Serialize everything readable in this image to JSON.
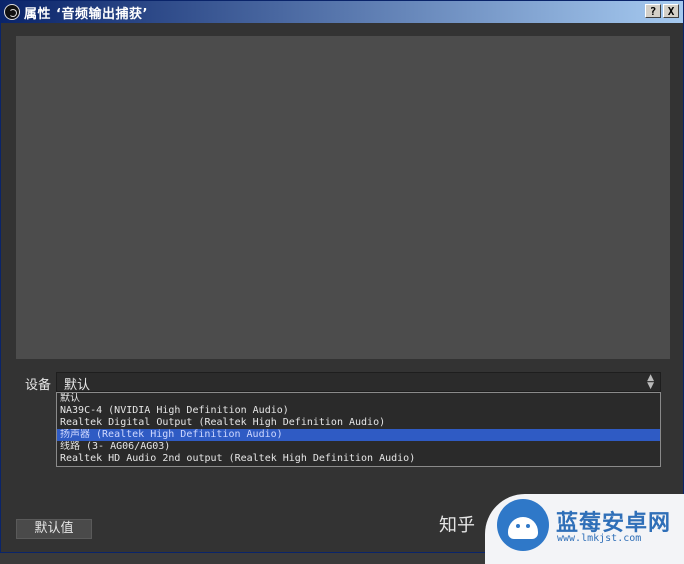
{
  "window": {
    "title": "属性 ‘音频输出捕获’",
    "help_button": "?",
    "close_button": "X"
  },
  "settings": {
    "device_label": "设备",
    "device_value": "默认",
    "dropdown_options": [
      "默认",
      "NA39C-4 (NVIDIA High Definition Audio)",
      "Realtek Digital Output (Realtek High Definition Audio)",
      "扬声器 (Realtek High Definition Audio)",
      "线路 (3- AG06/AG03)",
      "Realtek HD Audio 2nd output (Realtek High Definition Audio)"
    ],
    "selected_index": 3
  },
  "footer": {
    "defaults_button": "默认值"
  },
  "watermark": {
    "zhihu": "知乎",
    "brand": "蓝莓安卓网",
    "url": "www.lmkjst.com"
  },
  "icons": [
    "obs-app-icon",
    "help-icon",
    "close-icon",
    "combo-arrow-icon",
    "watermark-logo-icon"
  ],
  "colors": {
    "selection": "#2f5bc4",
    "titlebar_start": "#0a246a",
    "titlebar_end": "#a6caf0",
    "brand_blue": "#2f6fb8"
  }
}
